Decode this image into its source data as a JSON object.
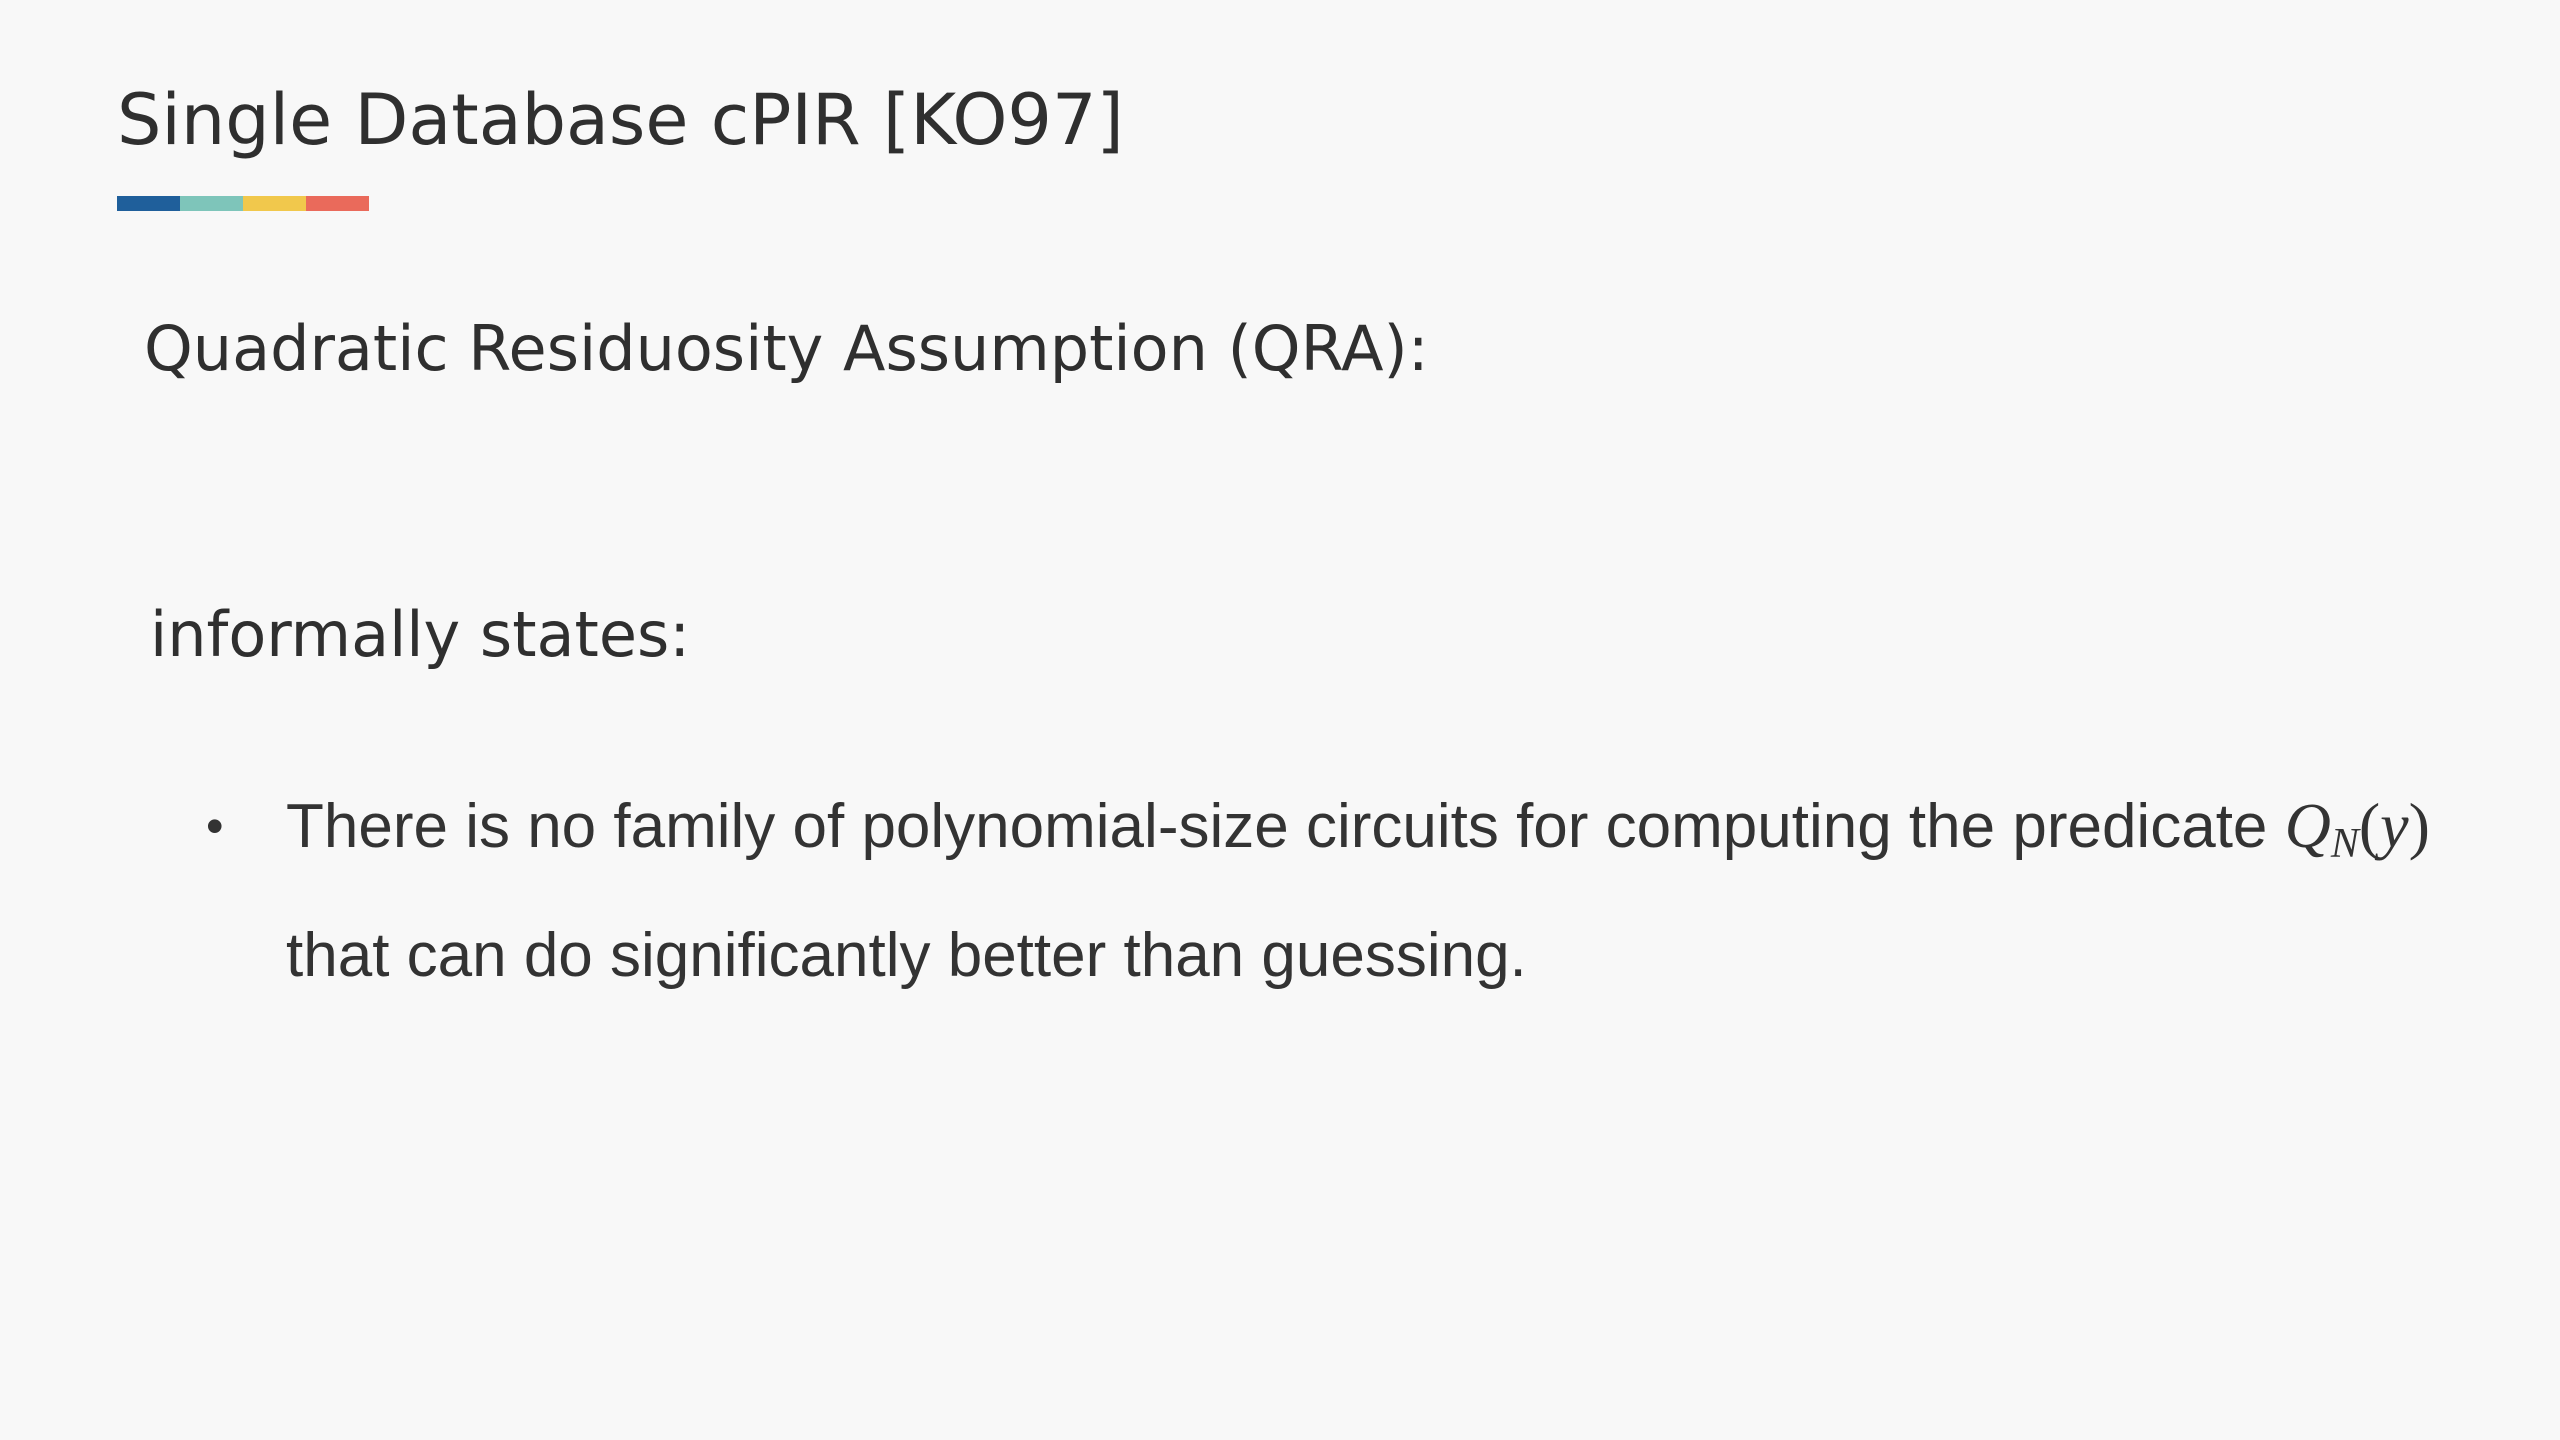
{
  "slide": {
    "title": "Single Database cPIR [KO97]",
    "accent_colors": [
      "#1f5f9b",
      "#7ec5ba",
      "#f1c84c",
      "#ea6a5b"
    ],
    "heading_qra": "Quadratic Residuosity Assumption (QRA):",
    "heading_informal": "informally states:",
    "bullet": {
      "marker": "•",
      "text_before": "There is no family of polynomial-size circuits for computing the predicate ",
      "math_symbol": "Q",
      "math_subscript": "N",
      "math_open": "(",
      "math_arg": "y",
      "math_close": ")",
      "text_after": " that can do significantly better than guessing."
    }
  }
}
